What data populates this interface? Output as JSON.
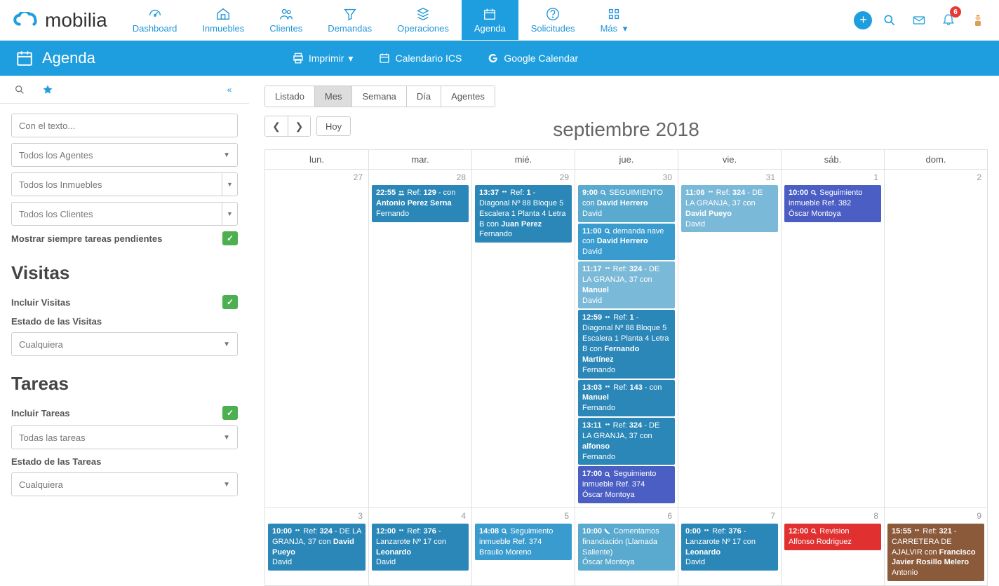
{
  "brand": "mobilia",
  "nav": [
    {
      "key": "dashboard",
      "label": "Dashboard"
    },
    {
      "key": "inmuebles",
      "label": "Inmuebles"
    },
    {
      "key": "clientes",
      "label": "Clientes"
    },
    {
      "key": "demandas",
      "label": "Demandas"
    },
    {
      "key": "operaciones",
      "label": "Operaciones"
    },
    {
      "key": "agenda",
      "label": "Agenda"
    },
    {
      "key": "solicitudes",
      "label": "Solicitudes"
    },
    {
      "key": "mas",
      "label": "Más"
    }
  ],
  "notifications_count": "6",
  "agendabar": {
    "title": "Agenda",
    "print": "Imprimir",
    "ics": "Calendario ICS",
    "google": "Google Calendar"
  },
  "sidebar": {
    "search_placeholder": "Con el texto...",
    "agents": "Todos los Agentes",
    "inmuebles": "Todos los Inmuebles",
    "clientes": "Todos los Clientes",
    "pending_label": "Mostrar siempre tareas pendientes",
    "visitas_heading": "Visitas",
    "incluir_visitas": "Incluir Visitas",
    "estado_visitas": "Estado de las Visitas",
    "cualquiera": "Cualquiera",
    "tareas_heading": "Tareas",
    "incluir_tareas": "Incluir Tareas",
    "todas_tareas": "Todas las tareas",
    "estado_tareas": "Estado de las Tareas"
  },
  "viewtabs": {
    "listado": "Listado",
    "mes": "Mes",
    "semana": "Semana",
    "dia": "Día",
    "agentes": "Agentes"
  },
  "today_btn": "Hoy",
  "month_title": "septiembre 2018",
  "weekdays": [
    "lun.",
    "mar.",
    "mié.",
    "jue.",
    "vie.",
    "sáb.",
    "dom."
  ],
  "row1_days": [
    "27",
    "28",
    "29",
    "30",
    "31",
    "1",
    "2"
  ],
  "row2_days": [
    "3",
    "4",
    "5",
    "6",
    "7",
    "8",
    "9"
  ],
  "events": {
    "d28_1": {
      "time": "22:55",
      "prefix": " Ref: ",
      "ref": "129",
      "rest": " - con ",
      "bold2": "Antonio Perez Serna",
      "line3": "Fernando"
    },
    "d29_1": {
      "time": "13:37",
      "prefix": " Ref: ",
      "ref": "1",
      "rest": " - Diagonal Nº 88 Bloque 5 Escalera 1 Planta 4 Letra B con ",
      "bold2": "Juan Perez",
      "line3": "Fernando"
    },
    "d30_1": {
      "time": "9:00",
      "rest": " SEGUIMIENTO con ",
      "bold2": "David Herrero",
      "line3": "David"
    },
    "d30_2": {
      "time": "11:00",
      "rest": " demanda nave con ",
      "bold2": "David Herrero",
      "line3": "David"
    },
    "d30_3": {
      "time": "11:17",
      "prefix": " Ref: ",
      "ref": "324",
      "rest": " - DE LA GRANJA, 37 con ",
      "bold2": "Manuel",
      "line3": "David"
    },
    "d30_4": {
      "time": "12:59",
      "prefix": " Ref: ",
      "ref": "1",
      "rest": " - Diagonal Nº 88 Bloque 5 Escalera 1 Planta 4 Letra B con ",
      "bold2": "Fernando Martínez",
      "line3": "Fernando"
    },
    "d30_5": {
      "time": "13:03",
      "prefix": " Ref: ",
      "ref": "143",
      "rest": " - con ",
      "bold2": "Manuel",
      "line3": "Fernando"
    },
    "d30_6": {
      "time": "13:11",
      "prefix": " Ref: ",
      "ref": "324",
      "rest": " - DE LA GRANJA, 37 con ",
      "bold2": "alfonso",
      "line3": "Fernando"
    },
    "d30_7": {
      "time": "17:00",
      "rest": " Seguimiento inmueble Ref. 374",
      "line3": "Óscar Montoya"
    },
    "d31_1": {
      "time": "11:06",
      "prefix": " Ref: ",
      "ref": "324",
      "rest": " - DE LA GRANJA, 37 con ",
      "bold2": "David Pueyo",
      "line3": "David"
    },
    "s1_1": {
      "time": "10:00",
      "rest": " Seguimiento inmueble Ref. 382",
      "line3": "Óscar Montoya"
    },
    "d3_1": {
      "time": "10:00",
      "prefix": " Ref: ",
      "ref": "324",
      "rest": " - DE LA GRANJA, 37 con ",
      "bold2": "David Pueyo",
      "line3": "David"
    },
    "d4_1": {
      "time": "12:00",
      "prefix": " Ref: ",
      "ref": "376",
      "rest": " - Lanzarote Nº 17 con ",
      "bold2": "Leonardo",
      "line3": "David"
    },
    "d5_1": {
      "time": "14:08",
      "rest": " Seguimiento inmueble Ref. 374",
      "line3": "Braulio Moreno"
    },
    "d6_1": {
      "time": "10:00",
      "rest": " Comentamos financiación (Llamada Saliente)",
      "line3": "Óscar Montoya"
    },
    "d7_1": {
      "time": "0:00",
      "prefix": " Ref: ",
      "ref": "376",
      "rest": " - Lanzarote Nº 17 con ",
      "bold2": "Leonardo",
      "line3": "David"
    },
    "d8_1": {
      "time": "12:00",
      "rest": " Revision",
      "line3": "Alfonso Rodriguez"
    },
    "d9_1": {
      "time": "15:55",
      "prefix": " Ref: ",
      "ref": "321",
      "rest": " - CARRETERA DE AJALVIR con ",
      "bold2": "Francisco Javier Rosillo Melero",
      "line3": "Antonio"
    }
  }
}
